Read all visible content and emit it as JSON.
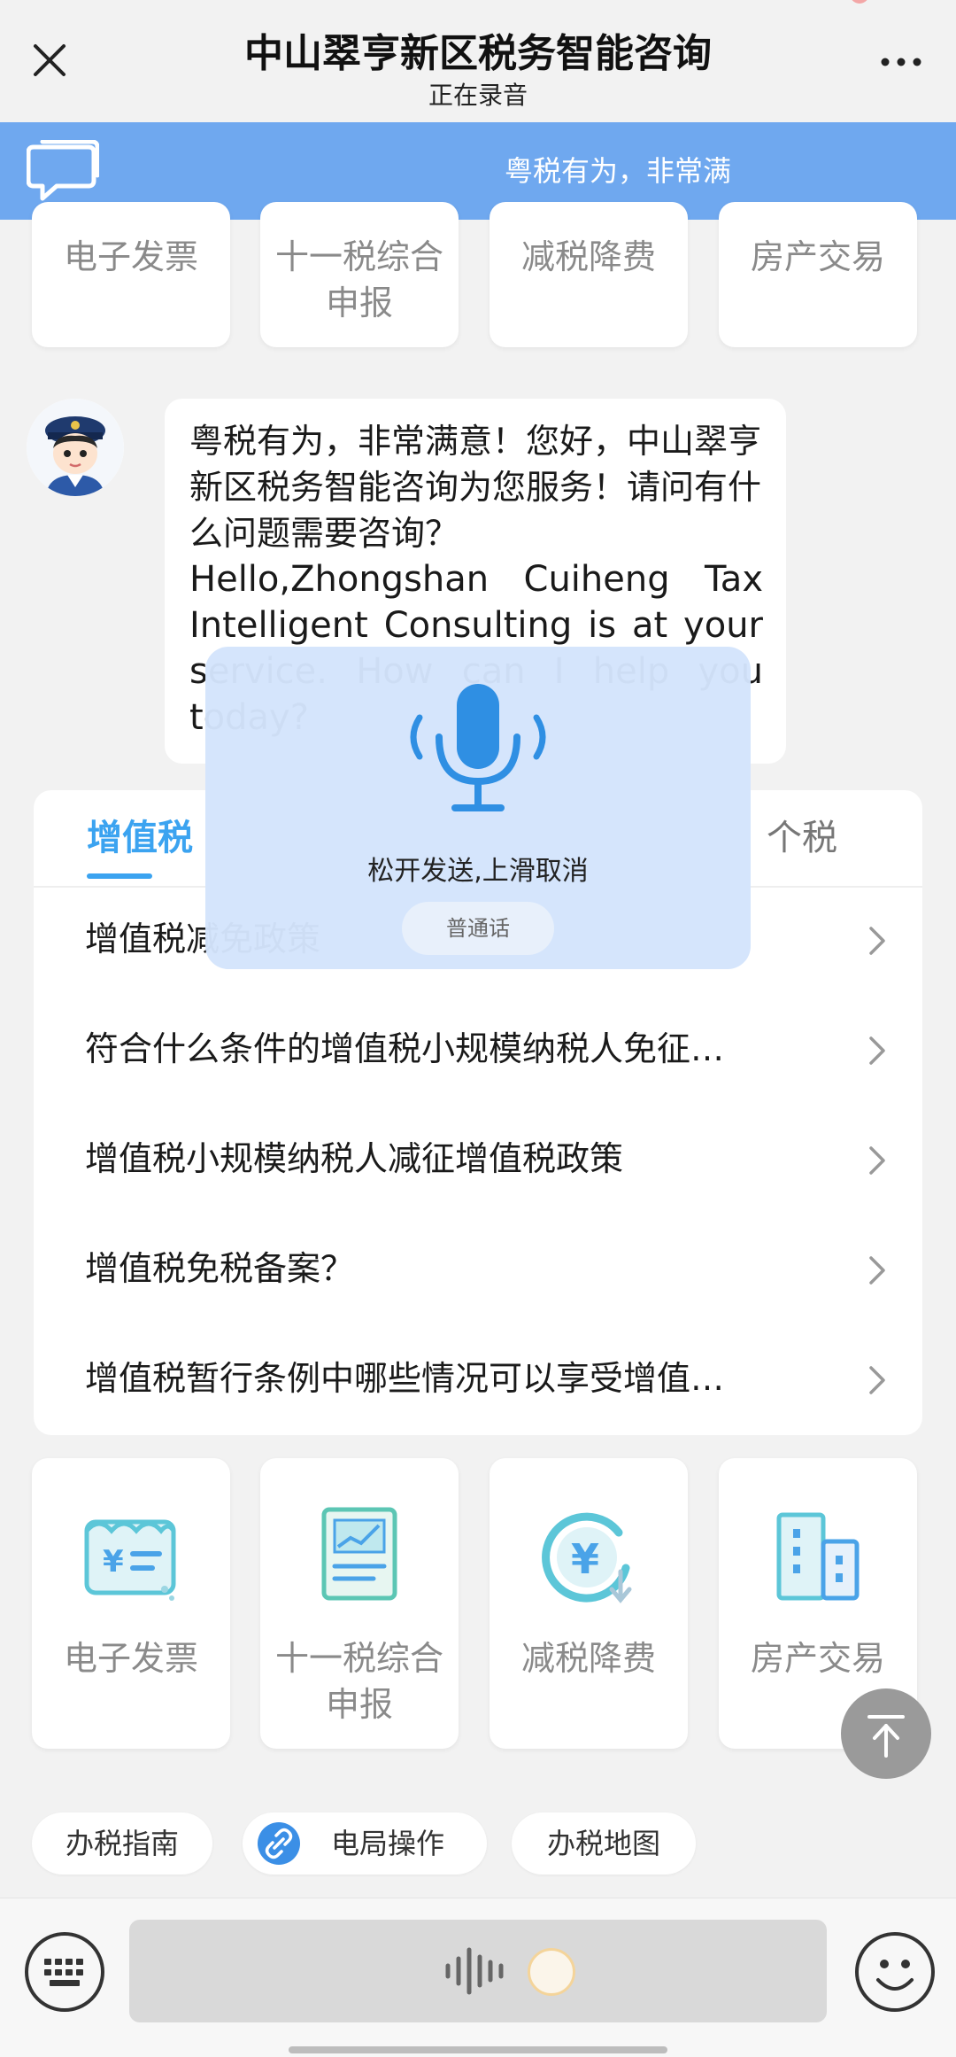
{
  "header": {
    "title": "中山翠亨新区税务智能咨询",
    "subtitle": "正在录音"
  },
  "notice": {
    "marquee_text": "粤税有为，非常满"
  },
  "services_top": [
    {
      "label_1": "电子发票",
      "label_2": ""
    },
    {
      "label_1": "十一税综合",
      "label_2": "申报"
    },
    {
      "label_1": "减税降费",
      "label_2": ""
    },
    {
      "label_1": "房产交易",
      "label_2": ""
    }
  ],
  "chat": {
    "message_cn": "粤税有为，非常满意！您好，中山翠亨新区税务智能咨询为您服务！请问有什么问题需要咨询？",
    "message_en": "Hello,Zhongshan Cuiheng Tax Intelligent Consulting is at your service. How can I help you today?"
  },
  "faq": {
    "tabs": [
      {
        "label": "增值税"
      },
      {
        "label": "个税"
      }
    ],
    "items": [
      {
        "question": "增值税减免政策"
      },
      {
        "question": "符合什么条件的增值税小规模纳税人免征…"
      },
      {
        "question": "增值税小规模纳税人减征增值税政策"
      },
      {
        "question": "增值税免税备案？"
      },
      {
        "question": "增值税暂行条例中哪些情况可以享受增值…"
      }
    ]
  },
  "voice_overlay": {
    "hint": "松开发送,上滑取消",
    "language": "普通话"
  },
  "services_bottom": [
    {
      "label_1": "电子发票",
      "label_2": "",
      "icon": "invoice-icon"
    },
    {
      "label_1": "十一税综合",
      "label_2": "申报",
      "icon": "tax-report-icon"
    },
    {
      "label_1": "减税降费",
      "label_2": "",
      "icon": "yuan-reduction-icon"
    },
    {
      "label_1": "房产交易",
      "label_2": "",
      "icon": "building-icon"
    }
  ],
  "quick_links": [
    {
      "label": "办税指南"
    },
    {
      "label": "电局操作",
      "icon": "link-icon"
    },
    {
      "label": "办税地图"
    }
  ],
  "colors": {
    "accent": "#3ba3f0",
    "notice_bar": "#6fa8ef",
    "icon_blue": "#4aa3e8",
    "icon_teal": "#5cc6d8"
  }
}
